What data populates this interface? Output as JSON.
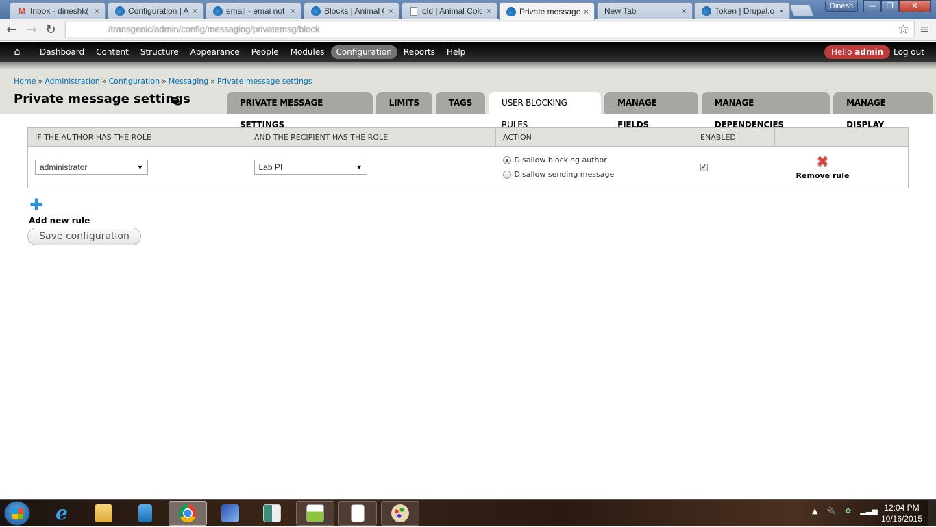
{
  "browser": {
    "tabs": [
      {
        "title": "Inbox - dineshk(",
        "favicon": "gmail-icon",
        "active": false
      },
      {
        "title": "Configuration | A",
        "favicon": "drupal-icon",
        "active": false
      },
      {
        "title": "email - emai not",
        "favicon": "drupal-drop-icon",
        "active": false
      },
      {
        "title": "Blocks | Animal C",
        "favicon": "drupal-icon",
        "active": false
      },
      {
        "title": "old | Animal Colo",
        "favicon": "document-icon",
        "active": false
      },
      {
        "title": "Private message",
        "favicon": "drupal-icon",
        "active": true
      },
      {
        "title": "New Tab",
        "favicon": "",
        "active": false
      },
      {
        "title": "Token | Drupal.o",
        "favicon": "drupal-icon",
        "active": false
      }
    ],
    "close_glyph": "×",
    "profile_name": "Dinesh",
    "url": "/transgenic/admin/config/messaging/privatemsg/block"
  },
  "admin_toolbar": {
    "items": [
      {
        "label": "Dashboard",
        "active": false
      },
      {
        "label": "Content",
        "active": false
      },
      {
        "label": "Structure",
        "active": false
      },
      {
        "label": "Appearance",
        "active": false
      },
      {
        "label": "People",
        "active": false
      },
      {
        "label": "Modules",
        "active": false
      },
      {
        "label": "Configuration",
        "active": true
      },
      {
        "label": "Reports",
        "active": false
      },
      {
        "label": "Help",
        "active": false
      }
    ],
    "hello_prefix": "Hello",
    "username": "admin",
    "logout": "Log out"
  },
  "breadcrumb": [
    "Home",
    "Administration",
    "Configuration",
    "Messaging",
    "Private message settings"
  ],
  "breadcrumb_separator": "»",
  "page_title": "Private message settings",
  "tabs": [
    {
      "label": "PRIVATE MESSAGE SETTINGS",
      "active": false
    },
    {
      "label": "LIMITS",
      "active": false
    },
    {
      "label": "TAGS",
      "active": false
    },
    {
      "label": "USER BLOCKING RULES",
      "active": true
    },
    {
      "label": "MANAGE FIELDS",
      "active": false
    },
    {
      "label": "MANAGE DEPENDENCIES",
      "active": false
    },
    {
      "label": "MANAGE DISPLAY",
      "active": false
    }
  ],
  "rules_table": {
    "headers": [
      "IF THE AUTHOR HAS THE ROLE",
      "AND THE RECIPIENT HAS THE ROLE",
      "ACTION",
      "ENABLED",
      ""
    ],
    "rows": [
      {
        "author_role": "administrator",
        "recipient_role": "Lab PI",
        "actions": [
          {
            "label": "Disallow blocking author",
            "checked": true
          },
          {
            "label": "Disallow sending message",
            "checked": false
          }
        ],
        "enabled": true,
        "remove_label": "Remove rule"
      }
    ]
  },
  "add_rule_label": "Add new rule",
  "save_button": "Save configuration",
  "taskbar": {
    "apps": [
      "Internet Explorer",
      "Windows Explorer",
      "Windows Media Player",
      "Google Chrome",
      "Remote Desktop",
      "Window App",
      "Notepad++",
      "Document App",
      "Paint"
    ],
    "clock_time": "12:04 PM",
    "clock_date": "10/16/2015"
  }
}
